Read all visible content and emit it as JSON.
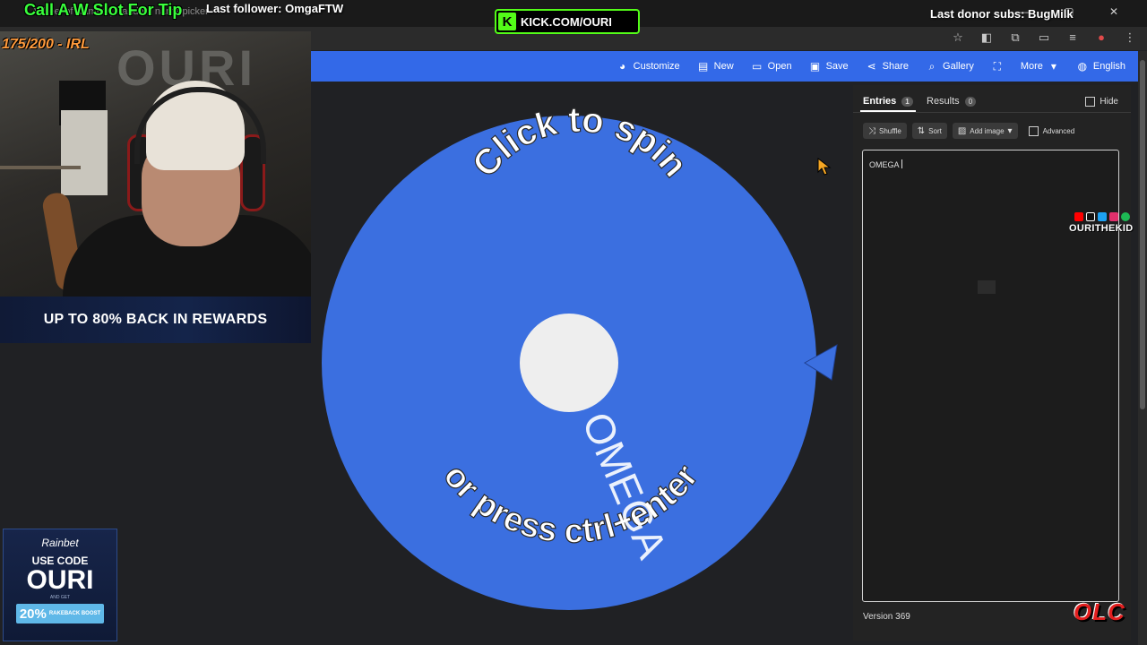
{
  "browser": {
    "tab_title": "Wheel of Names | Random name picker",
    "window_controls": "—  ▢  ✕",
    "icons": [
      "star-icon",
      "extension-icon",
      "puzzle-icon",
      "sidebar-icon",
      "media-icon",
      "profile-icon",
      "menu-icon"
    ]
  },
  "toolbar": {
    "items": [
      {
        "label": "Customize",
        "icon": "palette-icon"
      },
      {
        "label": "New",
        "icon": "file-icon"
      },
      {
        "label": "Open",
        "icon": "folder-icon"
      },
      {
        "label": "Save",
        "icon": "save-icon"
      },
      {
        "label": "Share",
        "icon": "share-icon"
      },
      {
        "label": "Gallery",
        "icon": "search-icon"
      },
      {
        "label": "",
        "icon": "fullscreen-icon"
      },
      {
        "label": "More",
        "icon": "chevron-down-icon"
      },
      {
        "label": "English",
        "icon": "globe-icon"
      }
    ],
    "accent": "#3369e8"
  },
  "wheel": {
    "color": "#3b6fe0",
    "prompt_top": "Click to spin",
    "prompt_bottom": "or press ctrl+enter",
    "entry_label": "OMEGA",
    "pointer_color": "#3b6fe0"
  },
  "side_panel": {
    "tabs": [
      {
        "label": "Entries",
        "count": "1"
      },
      {
        "label": "Results",
        "count": "0"
      }
    ],
    "hide_label": "Hide",
    "buttons": [
      {
        "label": "Shuffle",
        "icon": "shuffle-icon"
      },
      {
        "label": "Sort",
        "icon": "sort-icon"
      },
      {
        "label": "Add image",
        "icon": "image-icon"
      }
    ],
    "advanced_label": "Advanced",
    "entries_text": "OMEGA",
    "version": "Version 369"
  },
  "overlays": {
    "left_title": "Call A W Slot For Tip",
    "last_follower": "Last follower: OmgaFTW",
    "counter": "175/200 - IRL",
    "kick_letter": "K",
    "kick_url": "KICK.COM/OURI",
    "last_donor": "Last donor subs: BugMilk",
    "wall_logo": "OURI",
    "promo": "UP TO 80% BACK IN REWARDS",
    "social_handle": "OURITHEKID",
    "social_colors": [
      "#ff0000",
      "#000000",
      "#1da1f2",
      "#e1306c",
      "#1db954"
    ],
    "rainbet": {
      "brand": "Rainbet",
      "use_code": "USE CODE",
      "code": "OURI",
      "small": "AND GET",
      "boost_pct": "20%",
      "boost_text": "RAKEBACK BOOST"
    },
    "corner_logo": "OLC"
  }
}
